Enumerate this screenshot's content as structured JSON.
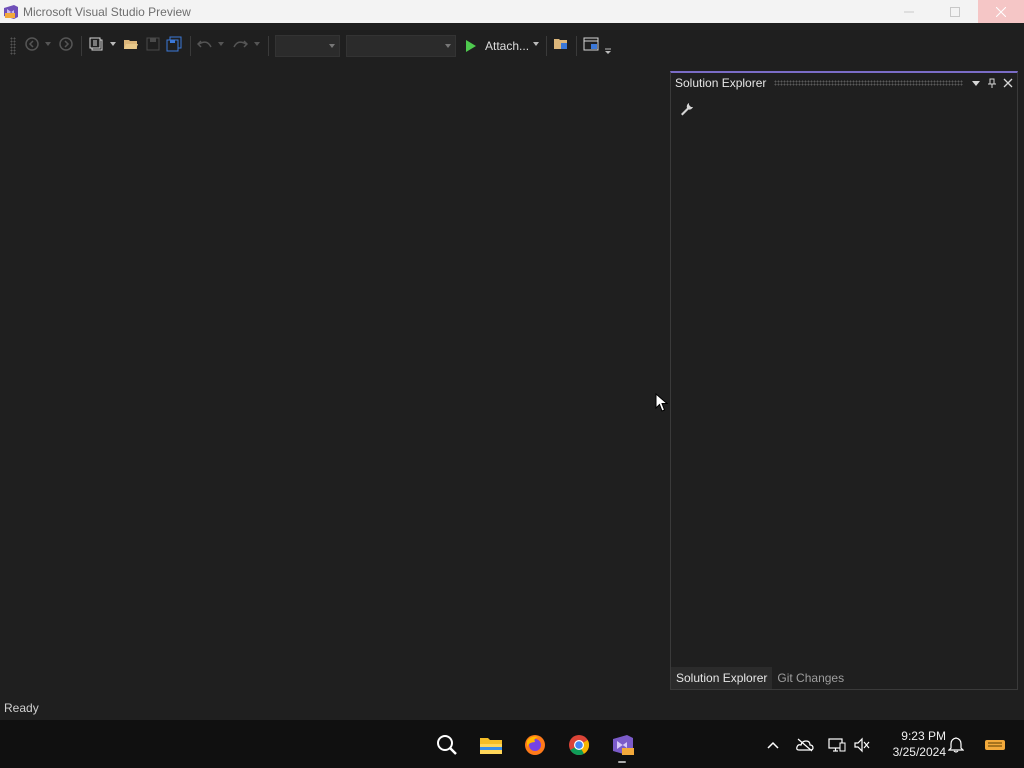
{
  "window": {
    "title": "Microsoft Visual Studio Preview"
  },
  "toolbar": {
    "start_label": "Attach...",
    "icons": [
      "navigate-back-icon",
      "navigate-forward-icon",
      "new-project-icon",
      "open-file-icon",
      "save-icon",
      "save-all-icon",
      "undo-icon",
      "redo-icon",
      "play-icon",
      "folder-view-icon",
      "layout-icon"
    ]
  },
  "solution_explorer": {
    "title": "Solution Explorer",
    "tabs": [
      {
        "label": "Solution Explorer",
        "active": true
      },
      {
        "label": "Git Changes",
        "active": false
      }
    ]
  },
  "statusbar": {
    "text": "Ready"
  },
  "taskbar": {
    "apps": [
      "search-icon",
      "file-explorer-icon",
      "firefox-icon",
      "chrome-icon",
      "visual-studio-preview-icon"
    ],
    "tray": [
      "show-hidden-icons-icon",
      "onedrive-icon",
      "network-icon",
      "volume-muted-icon",
      "notification-bell-icon"
    ],
    "time": "9:23 PM",
    "date": "3/25/2024"
  },
  "colors": {
    "accent": "#7a6cc6",
    "run_green": "#4ec94e",
    "background": "#1f1f1f"
  }
}
